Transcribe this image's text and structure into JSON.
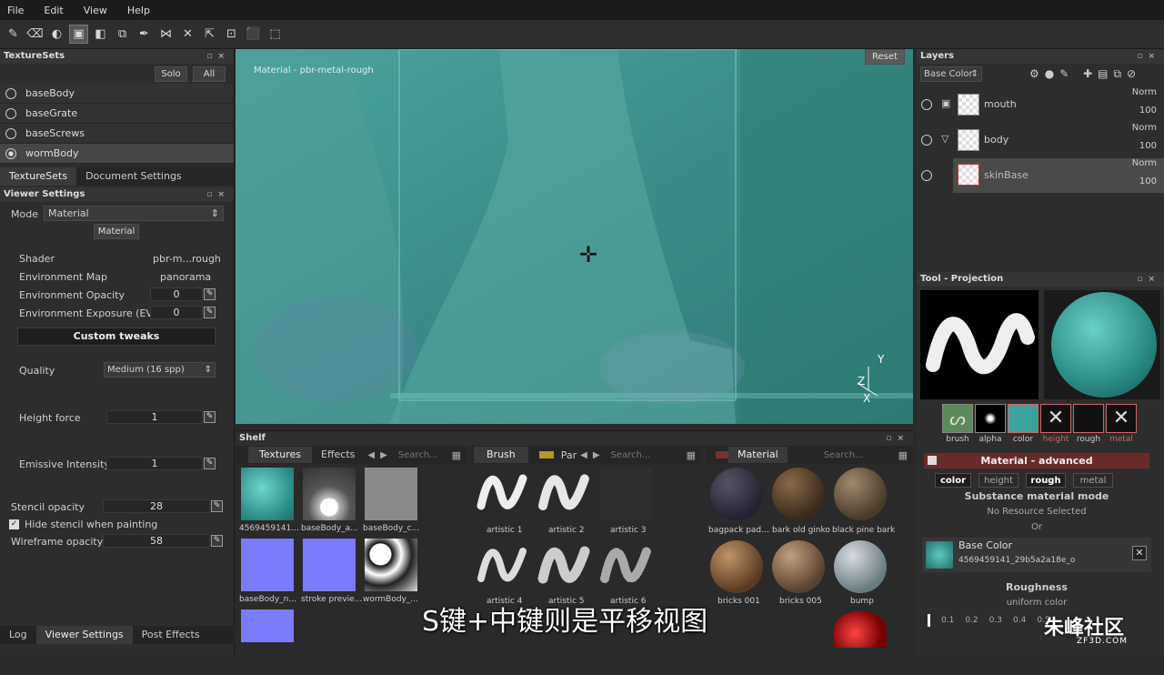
{
  "menu": [
    "File",
    "Edit",
    "View",
    "Help"
  ],
  "texture_sets": {
    "title": "TextureSets",
    "solo": "Solo",
    "all": "All",
    "items": [
      "baseBody",
      "baseGrate",
      "baseScrews",
      "wormBody"
    ],
    "tabs": [
      "TextureSets",
      "Document Settings"
    ]
  },
  "viewer_settings": {
    "title": "Viewer Settings",
    "mode_label": "Mode",
    "mode_value": "Material",
    "material_btn": "Material",
    "shader_label": "Shader",
    "shader_value": "pbr-m...rough",
    "env_map_label": "Environment Map",
    "env_map_value": "panorama",
    "env_opacity_label": "Environment Opacity",
    "env_opacity_value": "0",
    "env_exposure_label": "Environment Exposure (EV)",
    "env_exposure_value": "0",
    "custom_tweaks": "Custom tweaks",
    "quality_label": "Quality",
    "quality_value": "Medium (16 spp)",
    "height_force_label": "Height force",
    "height_force_value": "1",
    "emissive_label": "Emissive Intensity",
    "emissive_value": "1",
    "stencil_label": "Stencil opacity",
    "stencil_value": "28",
    "hide_stencil_label": "Hide stencil when painting",
    "wireframe_label": "Wireframe opacity",
    "wireframe_value": "58"
  },
  "bottom_tabs": [
    "Log",
    "Viewer Settings",
    "Post Effects"
  ],
  "viewport": {
    "label": "Material - pbr-metal-rough",
    "reset": "Reset",
    "axis_y": "Y",
    "axis_z": "Z",
    "axis_x": "X"
  },
  "layers": {
    "title": "Layers",
    "channel": "Base Color",
    "items": [
      {
        "name": "mouth",
        "blend": "Norm",
        "opacity": "100"
      },
      {
        "name": "body",
        "blend": "Norm",
        "opacity": "100"
      },
      {
        "name": "skinBase",
        "blend": "Norm",
        "opacity": "100"
      }
    ]
  },
  "tool": {
    "title": "Tool - Projection",
    "chips": [
      "brush",
      "alpha",
      "color",
      "height",
      "rough",
      "metal"
    ],
    "material_header": "Material - advanced",
    "channel_buttons": [
      "color",
      "height",
      "rough",
      "metal"
    ],
    "substance_mode": "Substance material mode",
    "no_resource": "No Resource Selected",
    "or": "Or",
    "base_color_label": "Base Color",
    "base_color_file": "4569459141_29b5a2a18e_o",
    "roughness_label": "Roughness",
    "roughness_sub": "uniform color",
    "scale": [
      "0.1",
      "0.2",
      "0.3",
      "0.4",
      "0.5"
    ]
  },
  "shelf": {
    "title": "Shelf",
    "tabs1": [
      "Textures",
      "Effects"
    ],
    "search": "Search...",
    "tab_brush": "Brush",
    "tab_par": "Par",
    "tab_material": "Material",
    "textures": [
      "4569459141...",
      "baseBody_a...",
      "baseBody_c...",
      "baseBody_n...",
      "stroke previe...",
      "wormBody_..."
    ],
    "brushes": [
      "artistic 1",
      "artistic 2",
      "artistic 3",
      "artistic 4",
      "artistic 5",
      "artistic 6"
    ],
    "materials": [
      "bagpack pad...",
      "bark old ginko",
      "black pine bark",
      "bricks 001",
      "bricks 005",
      "bump"
    ]
  },
  "subtitle": "S键+中键则是平移视图",
  "watermark": "朱峰社区",
  "watermark_url": "ZF3D.COM"
}
